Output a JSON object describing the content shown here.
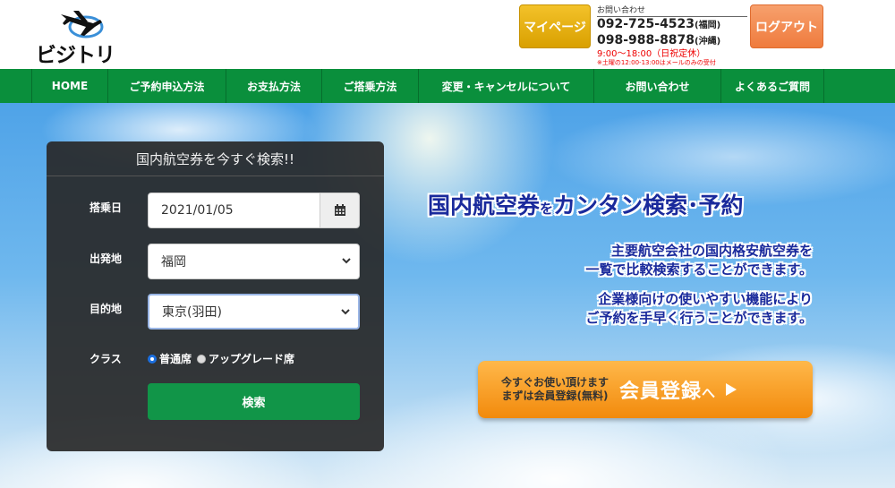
{
  "logo": {
    "text": "ビジトリ"
  },
  "header": {
    "mypage_label": "マイページ",
    "logout_label": "ログアウト",
    "contact_label": "お問い合わせ",
    "tel_fukuoka": "092-725-4523",
    "tel_fukuoka_area": "(福岡)",
    "tel_okinawa": "098-988-8878",
    "tel_okinawa_area": "(沖縄)",
    "hours": "9:00～18:00（日祝定休）",
    "note": "※土曜の12:00-13:00はメールのみの受付"
  },
  "nav": {
    "items": [
      {
        "label": "HOME"
      },
      {
        "label": "ご予約申込方法"
      },
      {
        "label": "お支払方法"
      },
      {
        "label": "ご搭乗方法"
      },
      {
        "label": "変更・キャンセルについて"
      },
      {
        "label": "お問い合わせ"
      },
      {
        "label": "よくあるご質問"
      }
    ]
  },
  "search": {
    "title": "国内航空券を今すぐ検索!!",
    "date_label": "搭乗日",
    "date_value": "2021/01/05",
    "from_label": "出発地",
    "from_value": "福岡",
    "to_label": "目的地",
    "to_value": "東京(羽田)",
    "class_label": "クラス",
    "class_options": [
      "普通席",
      "アップグレード席"
    ],
    "class_selected": "普通席",
    "submit_label": "検索"
  },
  "hero": {
    "title_a": "国内航空券",
    "title_b": "を",
    "title_c": "カンタン検索･予約",
    "desc1_line1": "主要航空会社の国内格安航空券を",
    "desc1_line2": "一覧で比較検索することができます。",
    "desc2_line1": "企業様向けの使いやすい機能により",
    "desc2_line2": "ご予約を手早く行うことができます。"
  },
  "register": {
    "sub_line1": "今すぐお使い頂けます",
    "sub_line2": "まずは会員登録(無料)",
    "main": "会員登録",
    "main_suffix": "へ"
  },
  "colors": {
    "nav_green": "#0a8f3c",
    "search_green": "#119548",
    "mypage_yellow": "#e3ad10",
    "logout_orange": "#ef7b3d",
    "title_navy": "#1a2a9c"
  },
  "icons": {
    "calendar": "calendar-icon",
    "select": "chevron-down-icon",
    "register_arrow": "play-arrow-icon",
    "logo": "airplane-icon"
  }
}
